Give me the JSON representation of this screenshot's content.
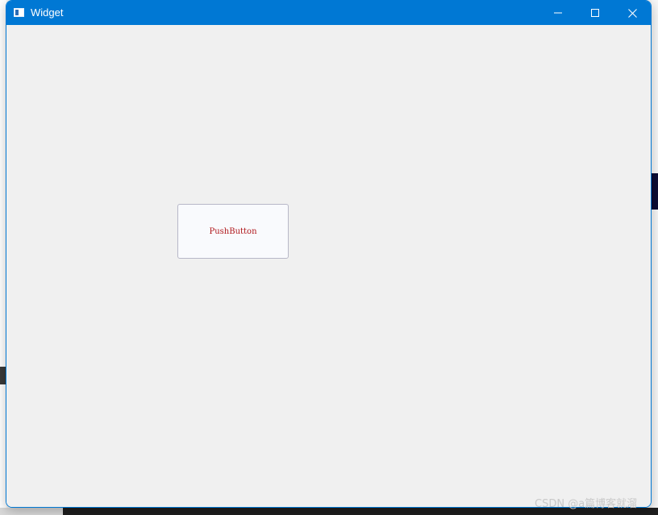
{
  "window": {
    "title": "Widget",
    "icons": {
      "app": "window-app-icon",
      "minimize": "minimize-icon",
      "maximize": "maximize-icon",
      "close": "close-icon"
    },
    "colors": {
      "titlebar": "#0078d4",
      "client": "#f0f0f0",
      "button_text": "#b0161a"
    }
  },
  "content": {
    "push_button_label": "PushButton"
  },
  "watermark": {
    "text": "CSDN @a篇博客就溜"
  }
}
